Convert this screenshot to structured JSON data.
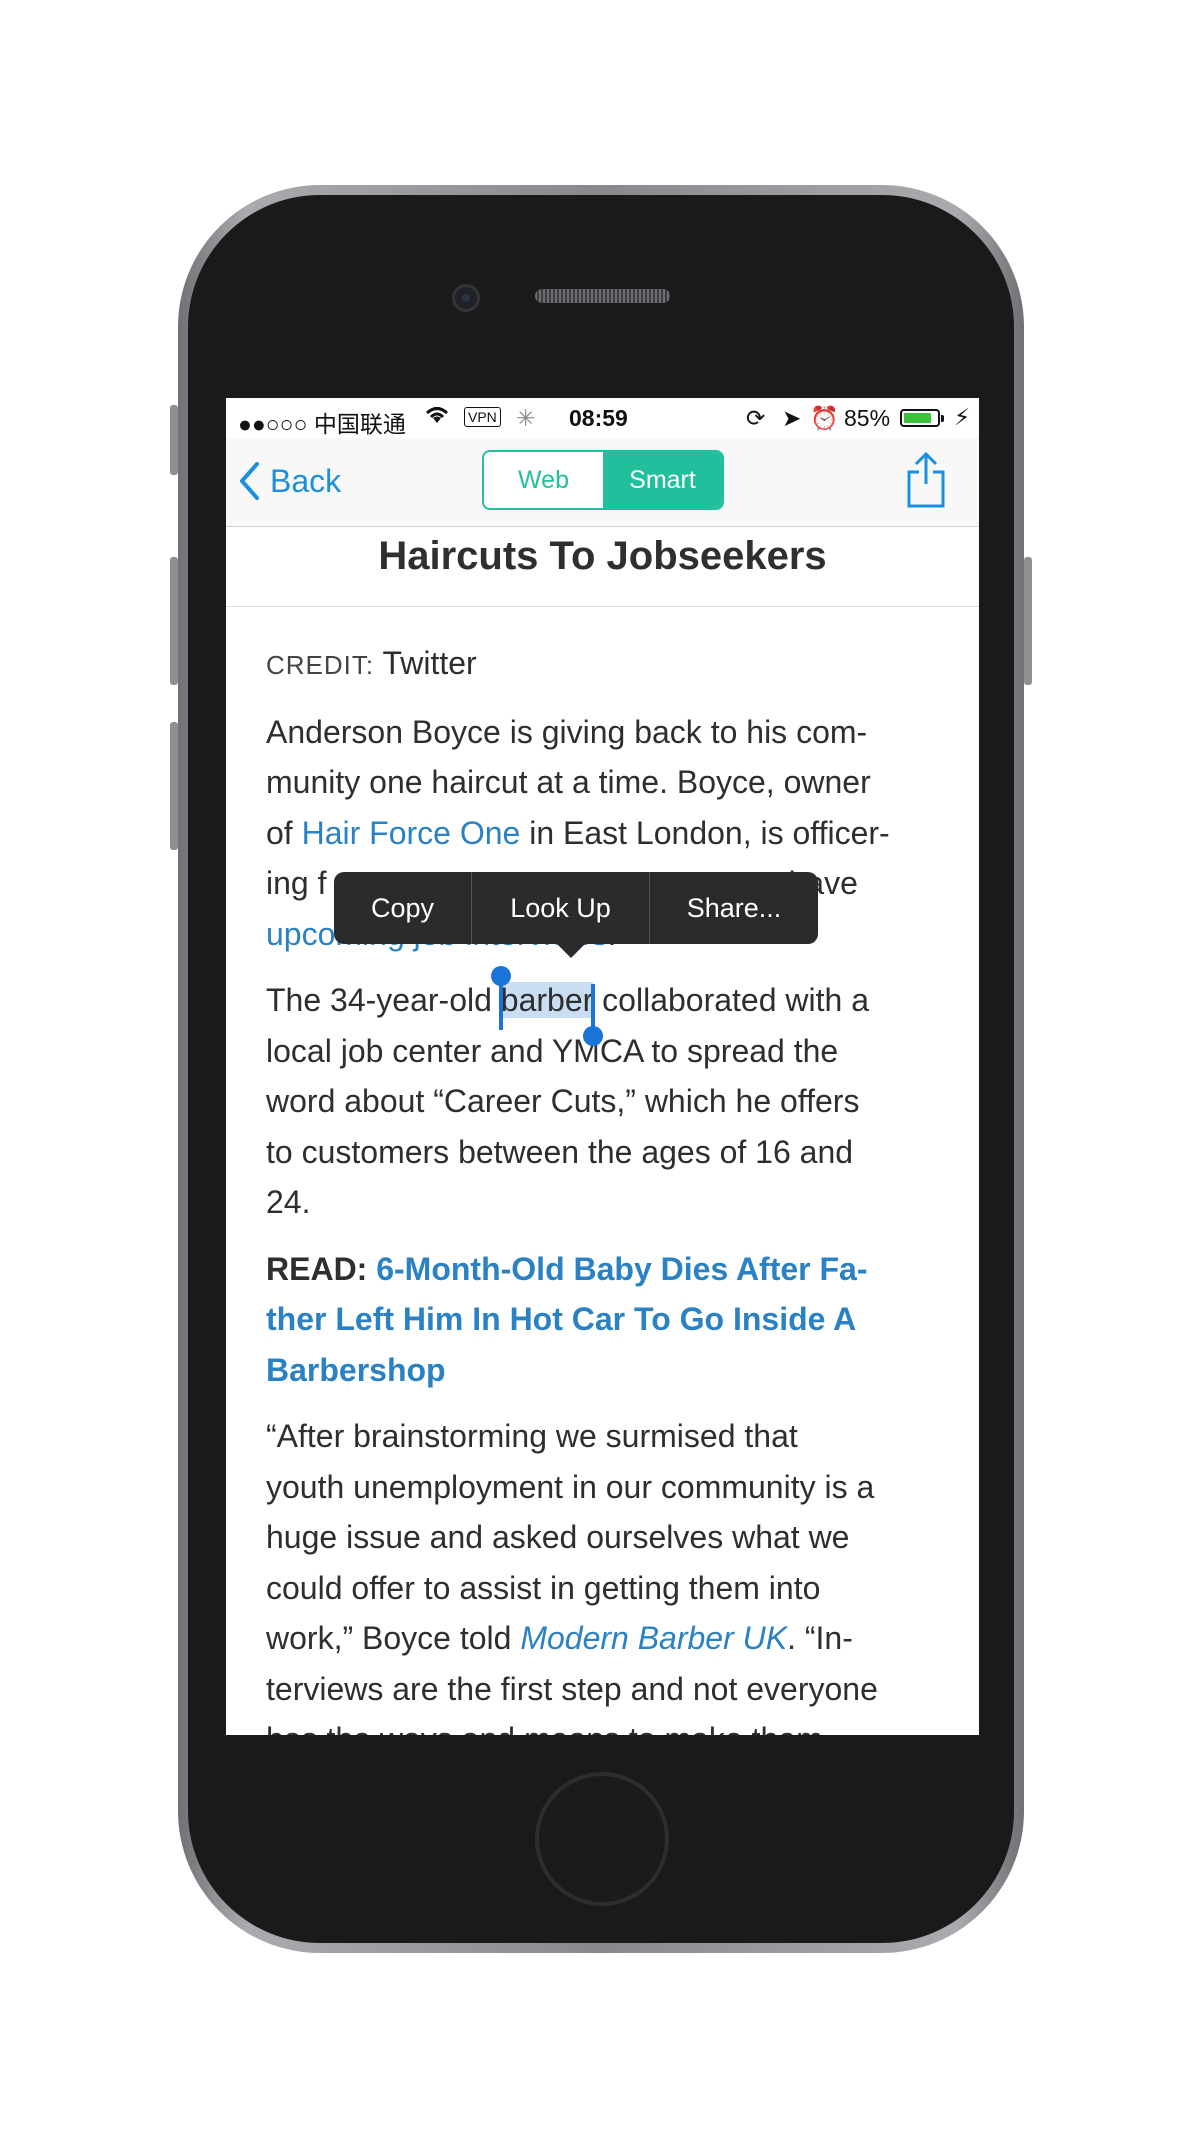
{
  "status_bar": {
    "carrier": "●●○○○ 中国联通",
    "vpn": "VPN",
    "time": "08:59",
    "battery_percent": "85%",
    "battery_level": 0.85
  },
  "nav": {
    "back_label": "Back",
    "segments": [
      "Web",
      "Smart"
    ],
    "selected_segment": "Smart"
  },
  "article": {
    "title": "Haircuts To Jobseekers",
    "credit_label": "CREDIT:",
    "credit_value": "Twitter",
    "p1": {
      "l1": "Anderson Boyce is giving back to his com-",
      "l2": "munity one haircut at a time. Boyce, owner",
      "l3a": "of ",
      "l3_link": "Hair Force One",
      "l3b": " in East London, is officer-",
      "l4a": "ing f",
      "l4b": "have",
      "l5_link": "upcoming job interviews",
      "l5b": "."
    },
    "p2": {
      "l1a": "The 34-year-old ",
      "l1_sel": "barber",
      "l1b": " collaborated with a",
      "l2": "local job center and YMCA to spread the",
      "l3": "word about “Career Cuts,” which he offers",
      "l4": "to customers between the ages of 16 and",
      "l5": "24."
    },
    "read": {
      "label": "READ:",
      "l1": "6-Month-Old Baby Dies After Fa-",
      "l2": "ther Left Him In Hot Car To Go Inside A",
      "l3": "Barbershop"
    },
    "quote": {
      "l1": "“After brainstorming we surmised that",
      "l2": "youth unemployment in our community is a",
      "l3": "huge issue and asked ourselves what we",
      "l4": "could offer to assist in getting them into",
      "l5a": "work,” Boyce told ",
      "l5_link": "Modern Barber UK",
      "l5b": ". “In-",
      "l6": "terviews are the first step and not everyone",
      "l7": "has the ways and means to make them"
    }
  },
  "context_menu": {
    "copy": "Copy",
    "look_up": "Look Up",
    "share": "Share..."
  },
  "colors": {
    "accent": "#22bf9c",
    "link": "#2a82c4",
    "back": "#1a8fe0"
  }
}
